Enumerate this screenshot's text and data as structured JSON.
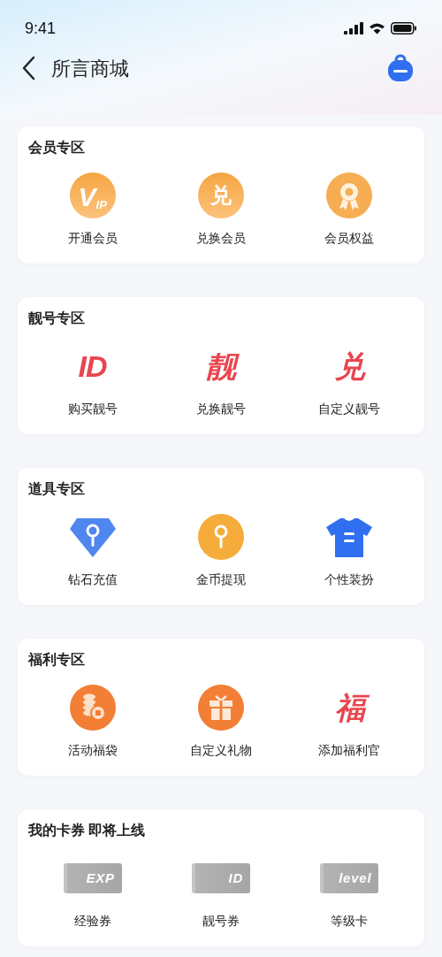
{
  "status_bar": {
    "time": "9:41"
  },
  "header": {
    "title": "所言商城"
  },
  "sections": [
    {
      "title": "会员专区",
      "items": [
        {
          "label": "开通会员",
          "kind": "vip",
          "glyph": "V",
          "glyph_small": "IP"
        },
        {
          "label": "兑换会员",
          "kind": "orange-glyph",
          "glyph": "兑"
        },
        {
          "label": "会员权益",
          "kind": "medal"
        }
      ]
    },
    {
      "title": "靓号专区",
      "items": [
        {
          "label": "购买靓号",
          "kind": "red-glyph",
          "glyph": "ID"
        },
        {
          "label": "兑换靓号",
          "kind": "red-glyph",
          "glyph": "靓"
        },
        {
          "label": "自定义靓号",
          "kind": "red-glyph",
          "glyph": "兑"
        }
      ]
    },
    {
      "title": "道具专区",
      "items": [
        {
          "label": "钻石充值",
          "kind": "diamond"
        },
        {
          "label": "金币提现",
          "kind": "coin"
        },
        {
          "label": "个性装扮",
          "kind": "shirt"
        }
      ]
    },
    {
      "title": "福利专区",
      "items": [
        {
          "label": "活动福袋",
          "kind": "coins"
        },
        {
          "label": "自定义礼物",
          "kind": "gift"
        },
        {
          "label": "添加福利官",
          "kind": "red-glyph",
          "glyph": "福"
        }
      ]
    },
    {
      "title": "我的卡券 即将上线",
      "items": [
        {
          "label": "经验券",
          "kind": "ticket",
          "glyph": "EXP"
        },
        {
          "label": "靓号券",
          "kind": "ticket",
          "glyph": "ID"
        },
        {
          "label": "等级卡",
          "kind": "ticket",
          "glyph": "level"
        }
      ]
    }
  ]
}
